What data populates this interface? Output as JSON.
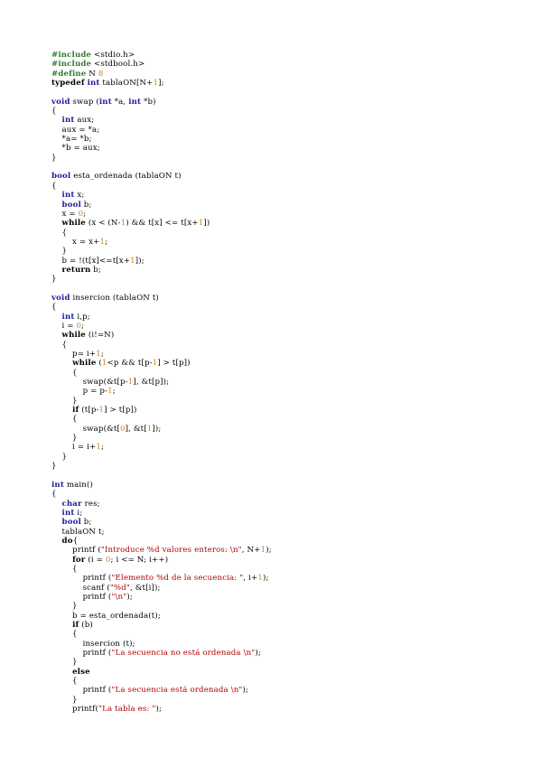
{
  "colors": {
    "keyword": "#000000",
    "type": "#1d1d9a",
    "preprocessor": "#2f7a2f",
    "number": "#d2850a",
    "string": "#b00000"
  },
  "lines": [
    [
      {
        "t": "pp",
        "v": "#include"
      },
      {
        "t": "",
        "v": " <stdio.h>"
      }
    ],
    [
      {
        "t": "pp",
        "v": "#include"
      },
      {
        "t": "",
        "v": " <stdbool.h>"
      }
    ],
    [
      {
        "t": "pp",
        "v": "#define"
      },
      {
        "t": "",
        "v": " N "
      },
      {
        "t": "num",
        "v": "8"
      }
    ],
    [
      {
        "t": "kw",
        "v": "typedef"
      },
      {
        "t": "",
        "v": " "
      },
      {
        "t": "ty",
        "v": "int"
      },
      {
        "t": "",
        "v": " tablaON[N+"
      },
      {
        "t": "num",
        "v": "1"
      },
      {
        "t": "",
        "v": "];"
      }
    ],
    [],
    [
      {
        "t": "ty",
        "v": "void"
      },
      {
        "t": "",
        "v": " swap ("
      },
      {
        "t": "ty",
        "v": "int"
      },
      {
        "t": "",
        "v": " *a, "
      },
      {
        "t": "ty",
        "v": "int"
      },
      {
        "t": "",
        "v": " *b)"
      }
    ],
    [
      {
        "t": "",
        "v": "{"
      }
    ],
    [
      {
        "t": "",
        "v": "    "
      },
      {
        "t": "ty",
        "v": "int"
      },
      {
        "t": "",
        "v": " aux;"
      }
    ],
    [
      {
        "t": "",
        "v": "    aux = *a;"
      }
    ],
    [
      {
        "t": "",
        "v": "    *a= *b;"
      }
    ],
    [
      {
        "t": "",
        "v": "    *b = aux;"
      }
    ],
    [
      {
        "t": "",
        "v": "}"
      }
    ],
    [],
    [
      {
        "t": "ty",
        "v": "bool"
      },
      {
        "t": "",
        "v": " esta_ordenada (tablaON t)"
      }
    ],
    [
      {
        "t": "",
        "v": "{"
      }
    ],
    [
      {
        "t": "",
        "v": "    "
      },
      {
        "t": "ty",
        "v": "int"
      },
      {
        "t": "",
        "v": " x;"
      }
    ],
    [
      {
        "t": "",
        "v": "    "
      },
      {
        "t": "ty",
        "v": "bool"
      },
      {
        "t": "",
        "v": " b;"
      }
    ],
    [
      {
        "t": "",
        "v": "    x = "
      },
      {
        "t": "num",
        "v": "0"
      },
      {
        "t": "",
        "v": ";"
      }
    ],
    [
      {
        "t": "",
        "v": "    "
      },
      {
        "t": "kw",
        "v": "while"
      },
      {
        "t": "",
        "v": " (x < (N-"
      },
      {
        "t": "num",
        "v": "1"
      },
      {
        "t": "",
        "v": ") && t[x] <= t[x+"
      },
      {
        "t": "num",
        "v": "1"
      },
      {
        "t": "",
        "v": "])"
      }
    ],
    [
      {
        "t": "",
        "v": "    {"
      }
    ],
    [
      {
        "t": "",
        "v": "        x = x+"
      },
      {
        "t": "num",
        "v": "1"
      },
      {
        "t": "",
        "v": ";"
      }
    ],
    [
      {
        "t": "",
        "v": "    }"
      }
    ],
    [
      {
        "t": "",
        "v": "    b = !(t[x]<=t[x+"
      },
      {
        "t": "num",
        "v": "1"
      },
      {
        "t": "",
        "v": "]);"
      }
    ],
    [
      {
        "t": "",
        "v": "    "
      },
      {
        "t": "kw",
        "v": "return"
      },
      {
        "t": "",
        "v": " b;"
      }
    ],
    [
      {
        "t": "",
        "v": "}"
      }
    ],
    [],
    [
      {
        "t": "ty",
        "v": "void"
      },
      {
        "t": "",
        "v": " insercion (tablaON t)"
      }
    ],
    [
      {
        "t": "",
        "v": "{"
      }
    ],
    [
      {
        "t": "",
        "v": "    "
      },
      {
        "t": "ty",
        "v": "int"
      },
      {
        "t": "",
        "v": " i,p;"
      }
    ],
    [
      {
        "t": "",
        "v": "    i = "
      },
      {
        "t": "num",
        "v": "0"
      },
      {
        "t": "",
        "v": ";"
      }
    ],
    [
      {
        "t": "",
        "v": "    "
      },
      {
        "t": "kw",
        "v": "while"
      },
      {
        "t": "",
        "v": " (i!=N)"
      }
    ],
    [
      {
        "t": "",
        "v": "    {"
      }
    ],
    [
      {
        "t": "",
        "v": "        p= i+"
      },
      {
        "t": "num",
        "v": "1"
      },
      {
        "t": "",
        "v": ";"
      }
    ],
    [
      {
        "t": "",
        "v": "        "
      },
      {
        "t": "kw",
        "v": "while"
      },
      {
        "t": "",
        "v": " ("
      },
      {
        "t": "num",
        "v": "1"
      },
      {
        "t": "",
        "v": "<p && t[p-"
      },
      {
        "t": "num",
        "v": "1"
      },
      {
        "t": "",
        "v": "] > t[p])"
      }
    ],
    [
      {
        "t": "",
        "v": "        {"
      }
    ],
    [
      {
        "t": "",
        "v": "            swap(&t[p-"
      },
      {
        "t": "num",
        "v": "1"
      },
      {
        "t": "",
        "v": "], &t[p]);"
      }
    ],
    [
      {
        "t": "",
        "v": "            p = p-"
      },
      {
        "t": "num",
        "v": "1"
      },
      {
        "t": "",
        "v": ";"
      }
    ],
    [
      {
        "t": "",
        "v": "        }"
      }
    ],
    [
      {
        "t": "",
        "v": "        "
      },
      {
        "t": "kw",
        "v": "if"
      },
      {
        "t": "",
        "v": " (t[p-"
      },
      {
        "t": "num",
        "v": "1"
      },
      {
        "t": "",
        "v": "] > t[p])"
      }
    ],
    [
      {
        "t": "",
        "v": "        {"
      }
    ],
    [
      {
        "t": "",
        "v": "            swap(&t["
      },
      {
        "t": "num",
        "v": "0"
      },
      {
        "t": "",
        "v": "], &t["
      },
      {
        "t": "num",
        "v": "1"
      },
      {
        "t": "",
        "v": "]);"
      }
    ],
    [
      {
        "t": "",
        "v": "        }"
      }
    ],
    [
      {
        "t": "",
        "v": "        i = i+"
      },
      {
        "t": "num",
        "v": "1"
      },
      {
        "t": "",
        "v": ";"
      }
    ],
    [
      {
        "t": "",
        "v": "    }"
      }
    ],
    [
      {
        "t": "",
        "v": "}"
      }
    ],
    [],
    [
      {
        "t": "ty",
        "v": "int"
      },
      {
        "t": "",
        "v": " main()"
      }
    ],
    [
      {
        "t": "",
        "v": "{"
      }
    ],
    [
      {
        "t": "",
        "v": "    "
      },
      {
        "t": "ty",
        "v": "char"
      },
      {
        "t": "",
        "v": " res;"
      }
    ],
    [
      {
        "t": "",
        "v": "    "
      },
      {
        "t": "ty",
        "v": "int"
      },
      {
        "t": "",
        "v": " i;"
      }
    ],
    [
      {
        "t": "",
        "v": "    "
      },
      {
        "t": "ty",
        "v": "bool"
      },
      {
        "t": "",
        "v": " b;"
      }
    ],
    [
      {
        "t": "",
        "v": "    tablaON t;"
      }
    ],
    [
      {
        "t": "",
        "v": "    "
      },
      {
        "t": "kw",
        "v": "do"
      },
      {
        "t": "",
        "v": "{"
      }
    ],
    [
      {
        "t": "",
        "v": "        printf ("
      },
      {
        "t": "str",
        "v": "\"Introduce %d valores enteros: \\n\""
      },
      {
        "t": "",
        "v": ", N+"
      },
      {
        "t": "num",
        "v": "1"
      },
      {
        "t": "",
        "v": ");"
      }
    ],
    [
      {
        "t": "",
        "v": "        "
      },
      {
        "t": "kw",
        "v": "for"
      },
      {
        "t": "",
        "v": " (i = "
      },
      {
        "t": "num",
        "v": "0"
      },
      {
        "t": "",
        "v": "; i <= N; i++)"
      }
    ],
    [
      {
        "t": "",
        "v": "        {"
      }
    ],
    [
      {
        "t": "",
        "v": "            printf ("
      },
      {
        "t": "str",
        "v": "\"Elemento %d de la secuencia: \""
      },
      {
        "t": "",
        "v": ", i+"
      },
      {
        "t": "num",
        "v": "1"
      },
      {
        "t": "",
        "v": ");"
      }
    ],
    [
      {
        "t": "",
        "v": "            scanf ("
      },
      {
        "t": "str",
        "v": "\"%d\""
      },
      {
        "t": "",
        "v": ", &t[i]);"
      }
    ],
    [
      {
        "t": "",
        "v": "            printf ("
      },
      {
        "t": "str",
        "v": "\"\\n\""
      },
      {
        "t": "",
        "v": ");"
      }
    ],
    [
      {
        "t": "",
        "v": "        }"
      }
    ],
    [
      {
        "t": "",
        "v": "        b = esta_ordenada(t);"
      }
    ],
    [
      {
        "t": "",
        "v": "        "
      },
      {
        "t": "kw",
        "v": "if"
      },
      {
        "t": "",
        "v": " (b)"
      }
    ],
    [
      {
        "t": "",
        "v": "        {"
      }
    ],
    [
      {
        "t": "",
        "v": "            insercion (t);"
      }
    ],
    [
      {
        "t": "",
        "v": "            printf ("
      },
      {
        "t": "str",
        "v": "\"La secuencia no está ordenada \\n\""
      },
      {
        "t": "",
        "v": ");"
      }
    ],
    [
      {
        "t": "",
        "v": "        }"
      }
    ],
    [
      {
        "t": "",
        "v": "        "
      },
      {
        "t": "kw",
        "v": "else"
      }
    ],
    [
      {
        "t": "",
        "v": "        {"
      }
    ],
    [
      {
        "t": "",
        "v": "            printf ("
      },
      {
        "t": "str",
        "v": "\"La secuencia está ordenada \\n\""
      },
      {
        "t": "",
        "v": ");"
      }
    ],
    [
      {
        "t": "",
        "v": "        }"
      }
    ],
    [
      {
        "t": "",
        "v": "        printf("
      },
      {
        "t": "str",
        "v": "\"La tabla es: \""
      },
      {
        "t": "",
        "v": ");"
      }
    ]
  ]
}
